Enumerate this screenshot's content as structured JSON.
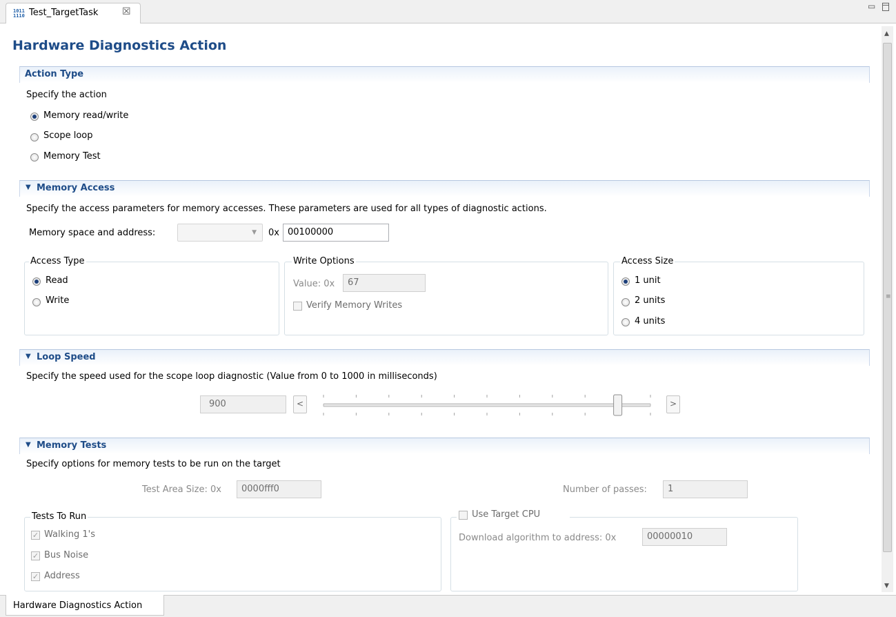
{
  "tab": {
    "title": "Test_TargetTask",
    "icon": "binary-file-icon",
    "close_glyph": "☒"
  },
  "window_controls": {
    "minimize": "minimize-icon",
    "maximize": "maximize-icon"
  },
  "form_title": "Hardware Diagnostics Action",
  "action_type": {
    "header": "Action Type",
    "description": "Specify the action",
    "options": [
      {
        "label": "Memory read/write",
        "selected": true
      },
      {
        "label": "Scope loop",
        "selected": false
      },
      {
        "label": "Memory Test",
        "selected": false
      }
    ]
  },
  "memory_access": {
    "header": "Memory Access",
    "description": "Specify the access parameters for memory accesses. These parameters are used for all types of diagnostic actions.",
    "space_label": "Memory space and address:",
    "space_value": "",
    "address_prefix": "0x",
    "address_value": "00100000",
    "access_type": {
      "title": "Access Type",
      "options": [
        {
          "label": "Read",
          "selected": true
        },
        {
          "label": "Write",
          "selected": false
        }
      ]
    },
    "write_options": {
      "title": "Write Options",
      "value_label": "Value: 0x",
      "value": "67",
      "verify_label": "Verify Memory Writes",
      "verify_checked": false
    },
    "access_size": {
      "title": "Access Size",
      "options": [
        {
          "label": "1 unit",
          "selected": true
        },
        {
          "label": "2 units",
          "selected": false
        },
        {
          "label": "4 units",
          "selected": false
        }
      ]
    }
  },
  "loop_speed": {
    "header": "Loop Speed",
    "description": "Specify the speed used for the scope loop diagnostic (Value from 0 to 1000 in milliseconds)",
    "value": "900",
    "decrement_label": "<",
    "increment_label": ">",
    "slider_min": 0,
    "slider_max": 1000,
    "slider_value": 900
  },
  "memory_tests": {
    "header": "Memory Tests",
    "description": "Specify options for memory tests to be run on the target",
    "area_label": "Test Area Size:  0x",
    "area_value": "0000fff0",
    "passes_label": "Number of passes:",
    "passes_value": "1",
    "tests_to_run": {
      "title": "Tests To Run",
      "items": [
        {
          "label": "Walking 1's",
          "checked": true
        },
        {
          "label": "Bus Noise",
          "checked": true
        },
        {
          "label": "Address",
          "checked": true
        }
      ]
    },
    "use_target_cpu": {
      "label": "Use Target CPU",
      "checked": false,
      "download_label": "Download algorithm to address:  0x",
      "download_value": "00000010"
    }
  },
  "bottom_tab": "Hardware Diagnostics Action"
}
